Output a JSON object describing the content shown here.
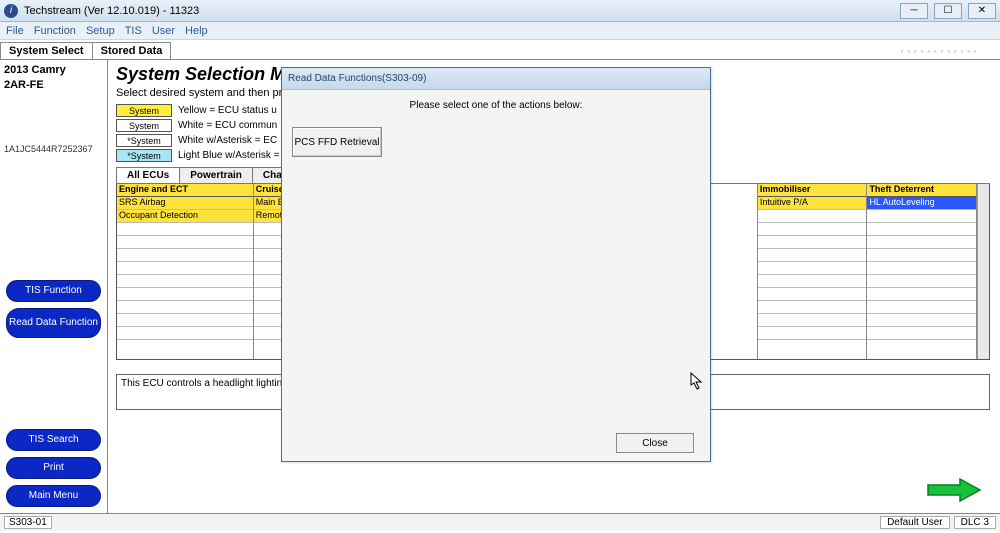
{
  "window": {
    "title": "Techstream (Ver 12.10.019) - 11323"
  },
  "menubar": [
    "File",
    "Function",
    "Setup",
    "TIS",
    "User",
    "Help"
  ],
  "maintabs": {
    "system_select": "System Select",
    "stored_data": "Stored Data"
  },
  "vehicle": {
    "model": "2013 Camry",
    "engine": "2AR-FE",
    "vin": "1A1JC5444R7252367"
  },
  "left_buttons": {
    "tis_function": "TIS Function",
    "read_data": "Read Data Function",
    "tis_search": "TIS Search",
    "print": "Print",
    "main_menu": "Main Menu"
  },
  "main": {
    "title": "System Selection Menu",
    "subtitle": "Select desired system and then press",
    "legends": {
      "yellow": "Yellow = ECU status u",
      "white": "White = ECU commun",
      "white_ast": "White w/Asterisk = EC",
      "blue_ast": "Light Blue w/Asterisk ="
    },
    "legend_btn": {
      "sys": "System",
      "sysa": "*System"
    },
    "systabs": {
      "all": "All ECUs",
      "pw": "Powertrain",
      "ch": "Chassi"
    },
    "grid": {
      "col1": {
        "h": "Engine and ECT",
        "r1": "SRS Airbag",
        "r2": "Occupant Detection"
      },
      "col2": {
        "h": "Cruise Cont",
        "r1": "Main Body",
        "r2": "Remote Engi"
      },
      "col3": {
        "h": "Immobiliser",
        "r1": "Intuitive P/A"
      },
      "col4": {
        "h": "Theft Deterrent",
        "r1": "HL AutoLeveling"
      }
    },
    "footnote": "This ECU controls a headlight lightin"
  },
  "dialog": {
    "title": "Read Data Functions(S303-09)",
    "message": "Please select one of the actions below:",
    "action": "PCS FFD Retrieval",
    "close": "Close"
  },
  "statusbar": {
    "code": "S303-01",
    "user": "Default User",
    "dlc": "DLC 3"
  }
}
